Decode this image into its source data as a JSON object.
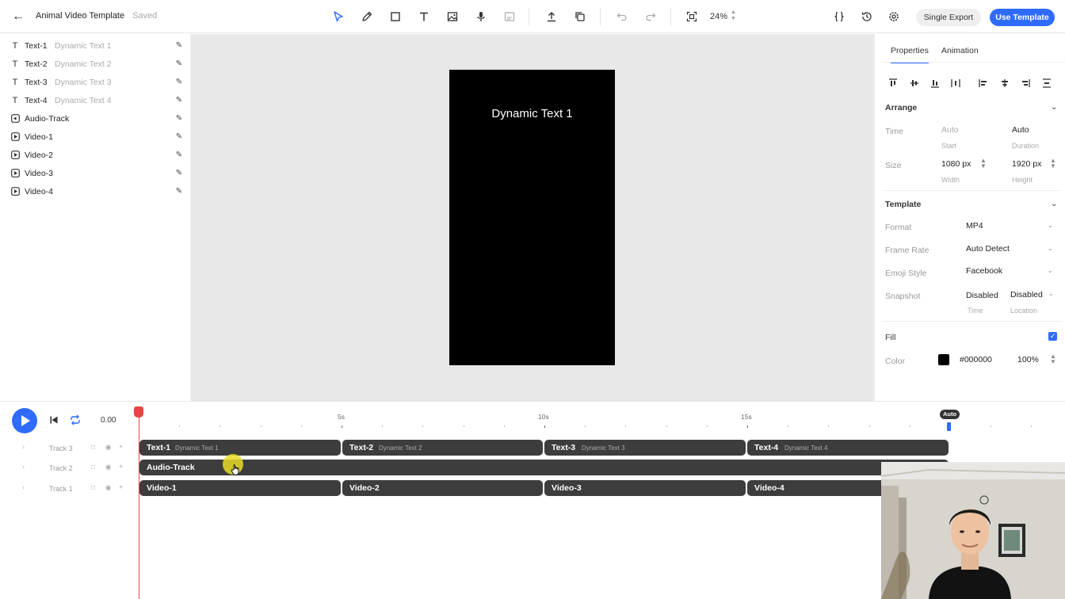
{
  "header": {
    "title": "Animal Video Template",
    "status": "Saved",
    "zoom": "24%",
    "single_export": "Single Export",
    "use_template": "Use Template"
  },
  "layers": [
    {
      "type": "text",
      "name": "Text-1",
      "sub": "Dynamic Text 1"
    },
    {
      "type": "text",
      "name": "Text-2",
      "sub": "Dynamic Text 2"
    },
    {
      "type": "text",
      "name": "Text-3",
      "sub": "Dynamic Text 3"
    },
    {
      "type": "text",
      "name": "Text-4",
      "sub": "Dynamic Text 4"
    },
    {
      "type": "audio",
      "name": "Audio-Track",
      "sub": ""
    },
    {
      "type": "video",
      "name": "Video-1",
      "sub": ""
    },
    {
      "type": "video",
      "name": "Video-2",
      "sub": ""
    },
    {
      "type": "video",
      "name": "Video-3",
      "sub": ""
    },
    {
      "type": "video",
      "name": "Video-4",
      "sub": ""
    }
  ],
  "canvas": {
    "text": "Dynamic Text 1",
    "background": "#000000"
  },
  "properties": {
    "tabs": [
      "Properties",
      "Animation"
    ],
    "arrange": {
      "heading": "Arrange",
      "time_label": "Time",
      "start_value": "Auto",
      "start_caption": "Start",
      "duration_value": "Auto",
      "duration_caption": "Duration",
      "size_label": "Size",
      "width_value": "1080 px",
      "width_caption": "Width",
      "height_value": "1920 px",
      "height_caption": "Height"
    },
    "template": {
      "heading": "Template",
      "format_label": "Format",
      "format_value": "MP4",
      "frame_rate_label": "Frame Rate",
      "frame_rate_value": "Auto Detect",
      "emoji_label": "Emoji Style",
      "emoji_value": "Facebook",
      "snapshot_label": "Snapshot",
      "snapshot_time_value": "Disabled",
      "snapshot_time_caption": "Time",
      "snapshot_location_value": "Disabled",
      "snapshot_location_caption": "Location"
    },
    "fill": {
      "label": "Fill",
      "checked": true,
      "color_label": "Color",
      "color_value": "#000000",
      "opacity": "100%"
    }
  },
  "timeline": {
    "time": "0.00",
    "ruler_labels": [
      "5s",
      "10s",
      "15s"
    ],
    "auto_badge": "Auto",
    "tracks": [
      {
        "label": "Track 3",
        "clips": [
          {
            "name": "Text-1",
            "sub": "Dynamic Text 1"
          },
          {
            "name": "Text-2",
            "sub": "Dynamic Text 2"
          },
          {
            "name": "Text-3",
            "sub": "Dynamic Text 3"
          },
          {
            "name": "Text-4",
            "sub": "Dynamic Text 4"
          }
        ]
      },
      {
        "label": "Track 2",
        "clips": [
          {
            "name": "Audio-Track",
            "sub": ""
          }
        ]
      },
      {
        "label": "Track 1",
        "clips": [
          {
            "name": "Video-1",
            "sub": ""
          },
          {
            "name": "Video-2",
            "sub": ""
          },
          {
            "name": "Video-3",
            "sub": ""
          },
          {
            "name": "Video-4",
            "sub": ""
          }
        ]
      }
    ]
  },
  "colors": {
    "accent": "#2f6bff",
    "playhead": "#e64545",
    "clip": "#3d3d3d"
  }
}
